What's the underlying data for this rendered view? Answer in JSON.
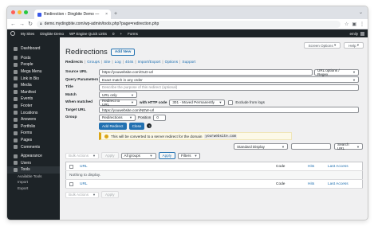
{
  "browser": {
    "tab_title": "Redirection ‹ Dingbite Demo —",
    "url": "demo.mydingbite.com/wp-admin/tools.php?page=redirection.php",
    "traffic_lights": [
      "#ff5f57",
      "#febc2e",
      "#28c840"
    ]
  },
  "adminbar": {
    "items": [
      "My Sites",
      "Dingbite Demo",
      "WP Engine Quick Links",
      "0",
      "+",
      "Forms"
    ],
    "user": "emily"
  },
  "sidebar": {
    "items": [
      {
        "label": "Dashboard"
      },
      {
        "label": "Posts"
      },
      {
        "label": "People"
      },
      {
        "label": "Mega Menu"
      },
      {
        "label": "Link in Bio"
      },
      {
        "label": "Media"
      },
      {
        "label": "Manifest"
      },
      {
        "label": "Events"
      },
      {
        "label": "Footer"
      },
      {
        "label": "Locations"
      },
      {
        "label": "Answers"
      },
      {
        "label": "Portfolio"
      },
      {
        "label": "Forms"
      },
      {
        "label": "Pages"
      },
      {
        "label": "Comments"
      },
      {
        "label": "Appearance"
      },
      {
        "label": "Users"
      },
      {
        "label": "Tools"
      }
    ],
    "subitems": [
      "Available Tools",
      "Import",
      "Export"
    ]
  },
  "header": {
    "screen_options": "Screen Options",
    "help": "Help",
    "title": "Redirections",
    "add_new": "Add New"
  },
  "subnav": [
    {
      "label": "Redirects"
    },
    {
      "label": "Groups"
    },
    {
      "label": "Site"
    },
    {
      "label": "Log"
    },
    {
      "label": "404s"
    },
    {
      "label": "Import/Export"
    },
    {
      "label": "Options"
    },
    {
      "label": "Support"
    }
  ],
  "form": {
    "source_label": "Source URL",
    "source_value": "https://youwebsite.com/OLD-url",
    "url_options": "URL options / Regex",
    "query_label": "Query Parameters",
    "query_value": "Exact match in any order",
    "title_label": "Title",
    "title_placeholder": "Describe the purpose of this redirect (optional)",
    "match_label": "Match",
    "match_value": "URL only",
    "when_label": "When matched",
    "when_value": "Redirect to URL",
    "http_label": "with HTTP code",
    "http_value": "301 - Moved Permanently",
    "exclude_label": "Exclude from logs",
    "target_label": "Target URL",
    "target_value": "https://youwebsite.com/NEW-url",
    "group_label": "Group",
    "group_value": "Redirections",
    "position_label": "Position",
    "position_value": "0",
    "add_button": "Add Redirect",
    "close_button": "Close",
    "notice_text": "This will be converted to a server redirect for the domain",
    "notice_domain": "yourwebsite.com"
  },
  "table_controls": {
    "display": "Standard Display",
    "search": "Search URL",
    "bulk_actions": "Bulk Actions",
    "apply": "Apply",
    "all_groups": "All groups",
    "filters": "Filters"
  },
  "table": {
    "columns": [
      "URL",
      "Code",
      "Hits",
      "Last Access"
    ],
    "empty": "Nothing to display."
  }
}
